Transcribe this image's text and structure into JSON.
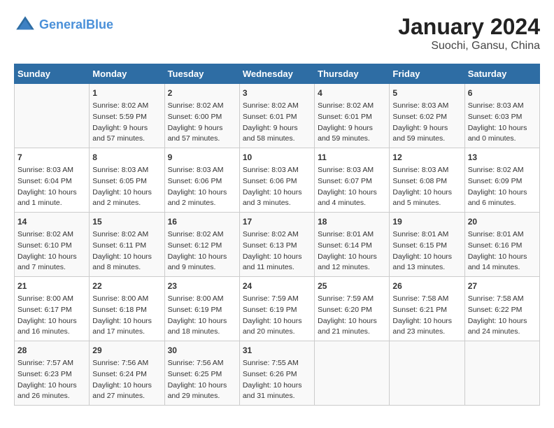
{
  "header": {
    "logo_line1": "General",
    "logo_line2": "Blue",
    "title": "January 2024",
    "subtitle": "Suochi, Gansu, China"
  },
  "days_of_week": [
    "Sunday",
    "Monday",
    "Tuesday",
    "Wednesday",
    "Thursday",
    "Friday",
    "Saturday"
  ],
  "weeks": [
    [
      {
        "day": "",
        "info": ""
      },
      {
        "day": "1",
        "info": "Sunrise: 8:02 AM\nSunset: 5:59 PM\nDaylight: 9 hours\nand 57 minutes."
      },
      {
        "day": "2",
        "info": "Sunrise: 8:02 AM\nSunset: 6:00 PM\nDaylight: 9 hours\nand 57 minutes."
      },
      {
        "day": "3",
        "info": "Sunrise: 8:02 AM\nSunset: 6:01 PM\nDaylight: 9 hours\nand 58 minutes."
      },
      {
        "day": "4",
        "info": "Sunrise: 8:02 AM\nSunset: 6:01 PM\nDaylight: 9 hours\nand 59 minutes."
      },
      {
        "day": "5",
        "info": "Sunrise: 8:03 AM\nSunset: 6:02 PM\nDaylight: 9 hours\nand 59 minutes."
      },
      {
        "day": "6",
        "info": "Sunrise: 8:03 AM\nSunset: 6:03 PM\nDaylight: 10 hours\nand 0 minutes."
      }
    ],
    [
      {
        "day": "7",
        "info": "Sunrise: 8:03 AM\nSunset: 6:04 PM\nDaylight: 10 hours\nand 1 minute."
      },
      {
        "day": "8",
        "info": "Sunrise: 8:03 AM\nSunset: 6:05 PM\nDaylight: 10 hours\nand 2 minutes."
      },
      {
        "day": "9",
        "info": "Sunrise: 8:03 AM\nSunset: 6:06 PM\nDaylight: 10 hours\nand 2 minutes."
      },
      {
        "day": "10",
        "info": "Sunrise: 8:03 AM\nSunset: 6:06 PM\nDaylight: 10 hours\nand 3 minutes."
      },
      {
        "day": "11",
        "info": "Sunrise: 8:03 AM\nSunset: 6:07 PM\nDaylight: 10 hours\nand 4 minutes."
      },
      {
        "day": "12",
        "info": "Sunrise: 8:03 AM\nSunset: 6:08 PM\nDaylight: 10 hours\nand 5 minutes."
      },
      {
        "day": "13",
        "info": "Sunrise: 8:02 AM\nSunset: 6:09 PM\nDaylight: 10 hours\nand 6 minutes."
      }
    ],
    [
      {
        "day": "14",
        "info": "Sunrise: 8:02 AM\nSunset: 6:10 PM\nDaylight: 10 hours\nand 7 minutes."
      },
      {
        "day": "15",
        "info": "Sunrise: 8:02 AM\nSunset: 6:11 PM\nDaylight: 10 hours\nand 8 minutes."
      },
      {
        "day": "16",
        "info": "Sunrise: 8:02 AM\nSunset: 6:12 PM\nDaylight: 10 hours\nand 9 minutes."
      },
      {
        "day": "17",
        "info": "Sunrise: 8:02 AM\nSunset: 6:13 PM\nDaylight: 10 hours\nand 11 minutes."
      },
      {
        "day": "18",
        "info": "Sunrise: 8:01 AM\nSunset: 6:14 PM\nDaylight: 10 hours\nand 12 minutes."
      },
      {
        "day": "19",
        "info": "Sunrise: 8:01 AM\nSunset: 6:15 PM\nDaylight: 10 hours\nand 13 minutes."
      },
      {
        "day": "20",
        "info": "Sunrise: 8:01 AM\nSunset: 6:16 PM\nDaylight: 10 hours\nand 14 minutes."
      }
    ],
    [
      {
        "day": "21",
        "info": "Sunrise: 8:00 AM\nSunset: 6:17 PM\nDaylight: 10 hours\nand 16 minutes."
      },
      {
        "day": "22",
        "info": "Sunrise: 8:00 AM\nSunset: 6:18 PM\nDaylight: 10 hours\nand 17 minutes."
      },
      {
        "day": "23",
        "info": "Sunrise: 8:00 AM\nSunset: 6:19 PM\nDaylight: 10 hours\nand 18 minutes."
      },
      {
        "day": "24",
        "info": "Sunrise: 7:59 AM\nSunset: 6:19 PM\nDaylight: 10 hours\nand 20 minutes."
      },
      {
        "day": "25",
        "info": "Sunrise: 7:59 AM\nSunset: 6:20 PM\nDaylight: 10 hours\nand 21 minutes."
      },
      {
        "day": "26",
        "info": "Sunrise: 7:58 AM\nSunset: 6:21 PM\nDaylight: 10 hours\nand 23 minutes."
      },
      {
        "day": "27",
        "info": "Sunrise: 7:58 AM\nSunset: 6:22 PM\nDaylight: 10 hours\nand 24 minutes."
      }
    ],
    [
      {
        "day": "28",
        "info": "Sunrise: 7:57 AM\nSunset: 6:23 PM\nDaylight: 10 hours\nand 26 minutes."
      },
      {
        "day": "29",
        "info": "Sunrise: 7:56 AM\nSunset: 6:24 PM\nDaylight: 10 hours\nand 27 minutes."
      },
      {
        "day": "30",
        "info": "Sunrise: 7:56 AM\nSunset: 6:25 PM\nDaylight: 10 hours\nand 29 minutes."
      },
      {
        "day": "31",
        "info": "Sunrise: 7:55 AM\nSunset: 6:26 PM\nDaylight: 10 hours\nand 31 minutes."
      },
      {
        "day": "",
        "info": ""
      },
      {
        "day": "",
        "info": ""
      },
      {
        "day": "",
        "info": ""
      }
    ]
  ]
}
